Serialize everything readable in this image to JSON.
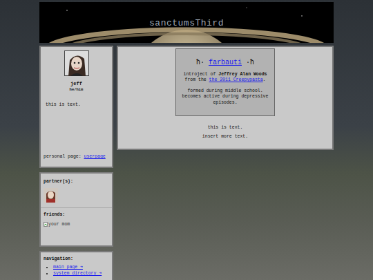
{
  "site": {
    "title": "sanctumsThird"
  },
  "profile": {
    "name": "jeff",
    "pronouns": "he/him",
    "bio": "this is text.",
    "personal_page_label": "personal page:",
    "personal_page_link": "userpage"
  },
  "relations": {
    "partners_label": "partner(s):",
    "friends_label": "friends:",
    "friends": [
      {
        "alt": "your mom"
      }
    ]
  },
  "navigation": {
    "label": "navigation:",
    "items": [
      "main page ➜",
      "system directory ➜"
    ]
  },
  "card": {
    "title_prefix": "ħ·",
    "title": "farbauti",
    "title_suffix": "·ħ",
    "intro": [
      {
        "kind": "text",
        "text": "introject of "
      },
      {
        "kind": "bold",
        "text": "Jeffrey Alan Woods"
      },
      {
        "kind": "text",
        "text": " from the "
      },
      {
        "kind": "link",
        "text": "the 2011 Creepypasta"
      },
      {
        "kind": "text",
        "text": "."
      }
    ],
    "notes": [
      "formed during middle school.",
      "becomes active during depressive episodes."
    ]
  },
  "main_text": [
    "this is text.",
    "insert more text."
  ]
}
